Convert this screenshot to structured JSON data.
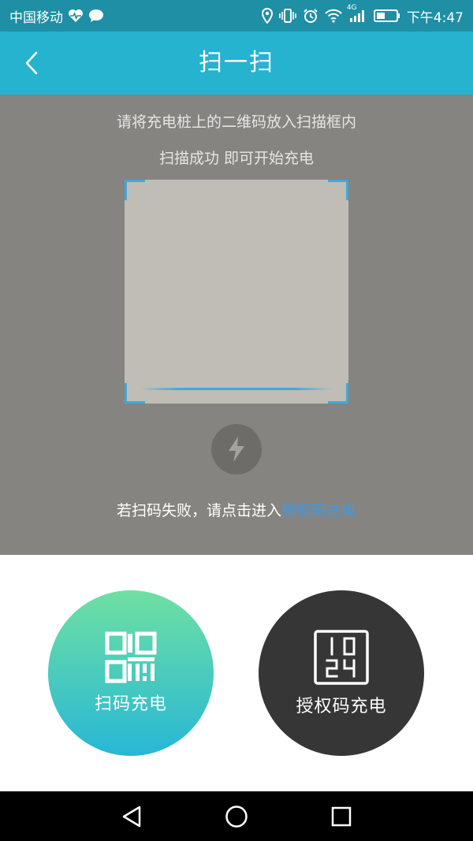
{
  "status_bar": {
    "carrier": "中国移动",
    "network": "4G",
    "time": "下午4:47",
    "icons": [
      "heart-rate-icon",
      "chat-bubble-icon",
      "location-icon",
      "vibrate-icon",
      "alarm-icon",
      "wifi-icon",
      "signal-icon",
      "battery-icon"
    ]
  },
  "header": {
    "title": "扫一扫",
    "back_icon": "chevron-left-icon"
  },
  "scanner": {
    "hint_line1": "请将充电桩上的二维码放入扫描框内",
    "hint_line2": "扫描成功 即可开始充电",
    "fail_prefix": "若扫码失败，请点击进入",
    "fail_link": "授权码充电",
    "flash_icon": "lightning-icon",
    "corner_color": "#41a8d8"
  },
  "modes": {
    "scan": {
      "label": "扫码充电",
      "icon": "qr-code-icon"
    },
    "auth": {
      "label": "授权码充电",
      "icon": "digits-code-icon",
      "icon_digits": [
        "1",
        "0",
        "2",
        "4"
      ]
    }
  },
  "nav": {
    "back_icon": "nav-back-triangle-icon",
    "home_icon": "nav-home-circle-icon",
    "recents_icon": "nav-recents-square-icon"
  },
  "colors": {
    "status_bar": "#1e8fa5",
    "header": "#25b3cf",
    "link": "#3f98e6",
    "scan_button_gradient": [
      "#6fe0a2",
      "#27b7d6"
    ],
    "auth_button": "#363636"
  }
}
